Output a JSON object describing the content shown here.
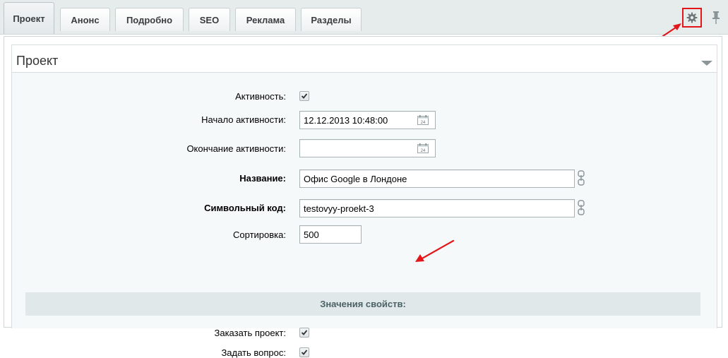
{
  "tabs": [
    {
      "label": "Проект",
      "active": true
    },
    {
      "label": "Анонс"
    },
    {
      "label": "Подробно"
    },
    {
      "label": "SEO"
    },
    {
      "label": "Реклама"
    },
    {
      "label": "Разделы"
    }
  ],
  "panel": {
    "title": "Проект"
  },
  "form": {
    "active_label": "Активность:",
    "active_checked": true,
    "start_label": "Начало активности:",
    "start_value": "12.12.2013 10:48:00",
    "end_label": "Окончание активности:",
    "end_value": "",
    "name_label": "Название:",
    "name_value": "Офис Google в Лондоне",
    "code_label": "Символьный код:",
    "code_value": "testovyy-proekt-3",
    "sort_label": "Сортировка:",
    "sort_value": "500"
  },
  "properties": {
    "section_title": "Значения свойств:",
    "order_label": "Заказать проект:",
    "order_checked": true,
    "question_label": "Задать вопрос:",
    "question_checked": true
  },
  "icons": {
    "calendar": "calendar-icon",
    "settings": "gear-icon",
    "pin": "pin-icon",
    "link": "chain-link-icon"
  },
  "colors": {
    "highlight": "#e3171b",
    "section_bg": "#e0e8ea",
    "section_text": "#4b6267"
  }
}
